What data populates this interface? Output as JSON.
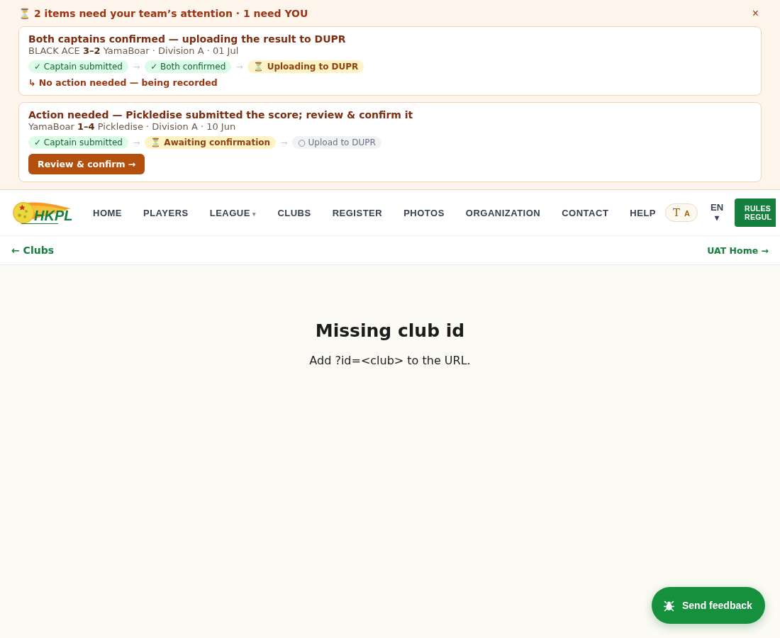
{
  "alert": {
    "icon": "⏳",
    "title": "2 items need your team’s attention · 1 need YOU",
    "close": "×",
    "items": [
      {
        "title": "Both captains confirmed — uploading the result to DUPR",
        "meta": "BLACK ACE **3–2** YamaBoar · Division A · 01 Jul",
        "steps": [
          {
            "kind": "done",
            "label": "✓ Captain submitted"
          },
          {
            "kind": "done",
            "label": "✓ Both confirmed"
          },
          {
            "kind": "pending",
            "label": "⏳ Uploading to DUPR"
          }
        ],
        "arrows": [
          "→",
          "→"
        ],
        "footer": {
          "kind": "note",
          "label": "↳ No action needed — being recorded"
        }
      },
      {
        "title": "Action needed — Pickledise submitted the score; review & confirm it",
        "meta": "YamaBoar **1–4** Pickledise · Division A · 10 Jun",
        "steps": [
          {
            "kind": "done",
            "label": "✓ Captain submitted"
          },
          {
            "kind": "pending",
            "label": "⏳ Awaiting confirmation"
          },
          {
            "kind": "todo",
            "label": "○ Upload to DUPR"
          }
        ],
        "arrows": [
          "→",
          "→"
        ],
        "footer": {
          "kind": "button",
          "label": "Review & confirm →"
        }
      }
    ]
  },
  "nav": {
    "logo": {
      "text": "HKPL"
    },
    "items": [
      {
        "label": "HOME"
      },
      {
        "label": "PLAYERS"
      },
      {
        "label": "LEAGUE",
        "caret": "▾"
      },
      {
        "label": "CLUBS"
      },
      {
        "label": "REGISTER"
      },
      {
        "label": "PHOTOS"
      },
      {
        "label": "ORGANIZATION"
      },
      {
        "label": "CONTACT"
      },
      {
        "label": "HELP"
      }
    ],
    "font_toggle": {
      "big": "T",
      "small": "A"
    },
    "language": {
      "code": "EN",
      "caret": "▾"
    },
    "rules_button": [
      "RULES",
      "REGUL"
    ]
  },
  "breadcrumb": {
    "back": "← Clubs",
    "home": "UAT Home →"
  },
  "main": {
    "heading": "Missing club id",
    "message": "Add ?id=<club> to the URL."
  },
  "feedback_button": "Send feedback"
}
